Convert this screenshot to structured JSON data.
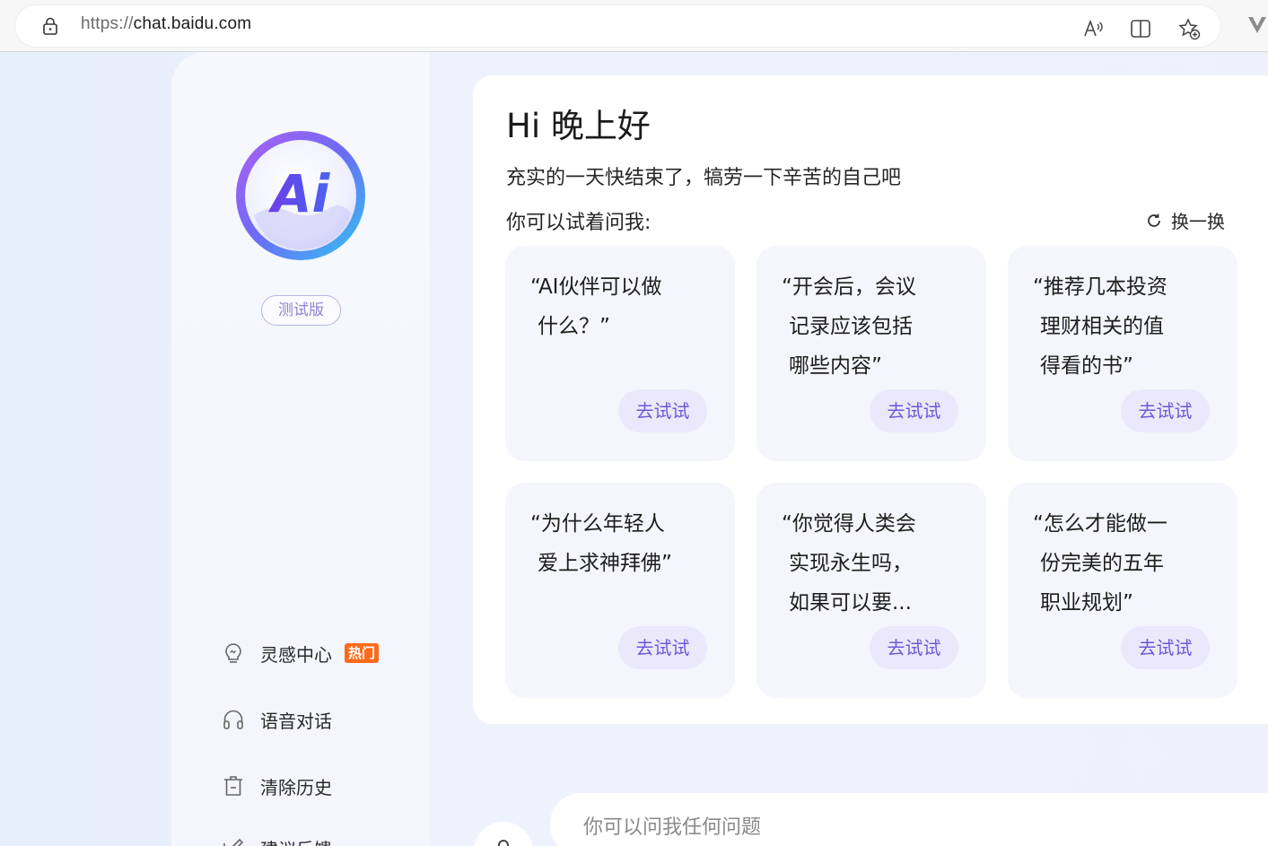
{
  "browser": {
    "url_scheme": "https://",
    "url_host": "chat.baidu.com",
    "icons": [
      "lock-icon",
      "read-aloud-icon",
      "split-screen-icon",
      "add-favorite-icon",
      "extension-icon"
    ]
  },
  "sidebar": {
    "logo_text": "Ai",
    "beta_label": "测试版",
    "items": [
      {
        "label": "灵感中心",
        "icon": "lightbulb-icon",
        "badge": "热门"
      },
      {
        "label": "语音对话",
        "icon": "headphones-icon"
      },
      {
        "label": "清除历史",
        "icon": "trash-icon"
      },
      {
        "label": "建议反馈",
        "icon": "feedback-icon"
      }
    ]
  },
  "main": {
    "greeting": "Hi 晚上好",
    "subtitle": "充实的一天快结束了，犒劳一下辛苦的自己吧",
    "try_ask": "你可以试着问我:",
    "refresh_label": "换一换",
    "prompts": [
      {
        "text": "“AI伙伴可以做  什么？”",
        "button": "去试试"
      },
      {
        "text": "“开会后，会议  记录应该包括  哪些内容”",
        "button": "去试试"
      },
      {
        "text": "“推荐几本投资  理财相关的值  得看的书”",
        "button": "去试试"
      },
      {
        "text": "“为什么年轻人  爱上求神拜佛”",
        "button": "去试试"
      },
      {
        "text": "“你觉得人类会  实现永生吗，  如果可以要...",
        "button": "去试试"
      },
      {
        "text": "“怎么才能做一  份完美的五年  职业规划”",
        "button": "去试试"
      }
    ]
  },
  "input": {
    "placeholder": "你可以问我任何问题"
  },
  "colors": {
    "accent": "#6a5bd8",
    "hot_badge": "#ff6a1a",
    "card_bg": "#f5f6fd"
  }
}
